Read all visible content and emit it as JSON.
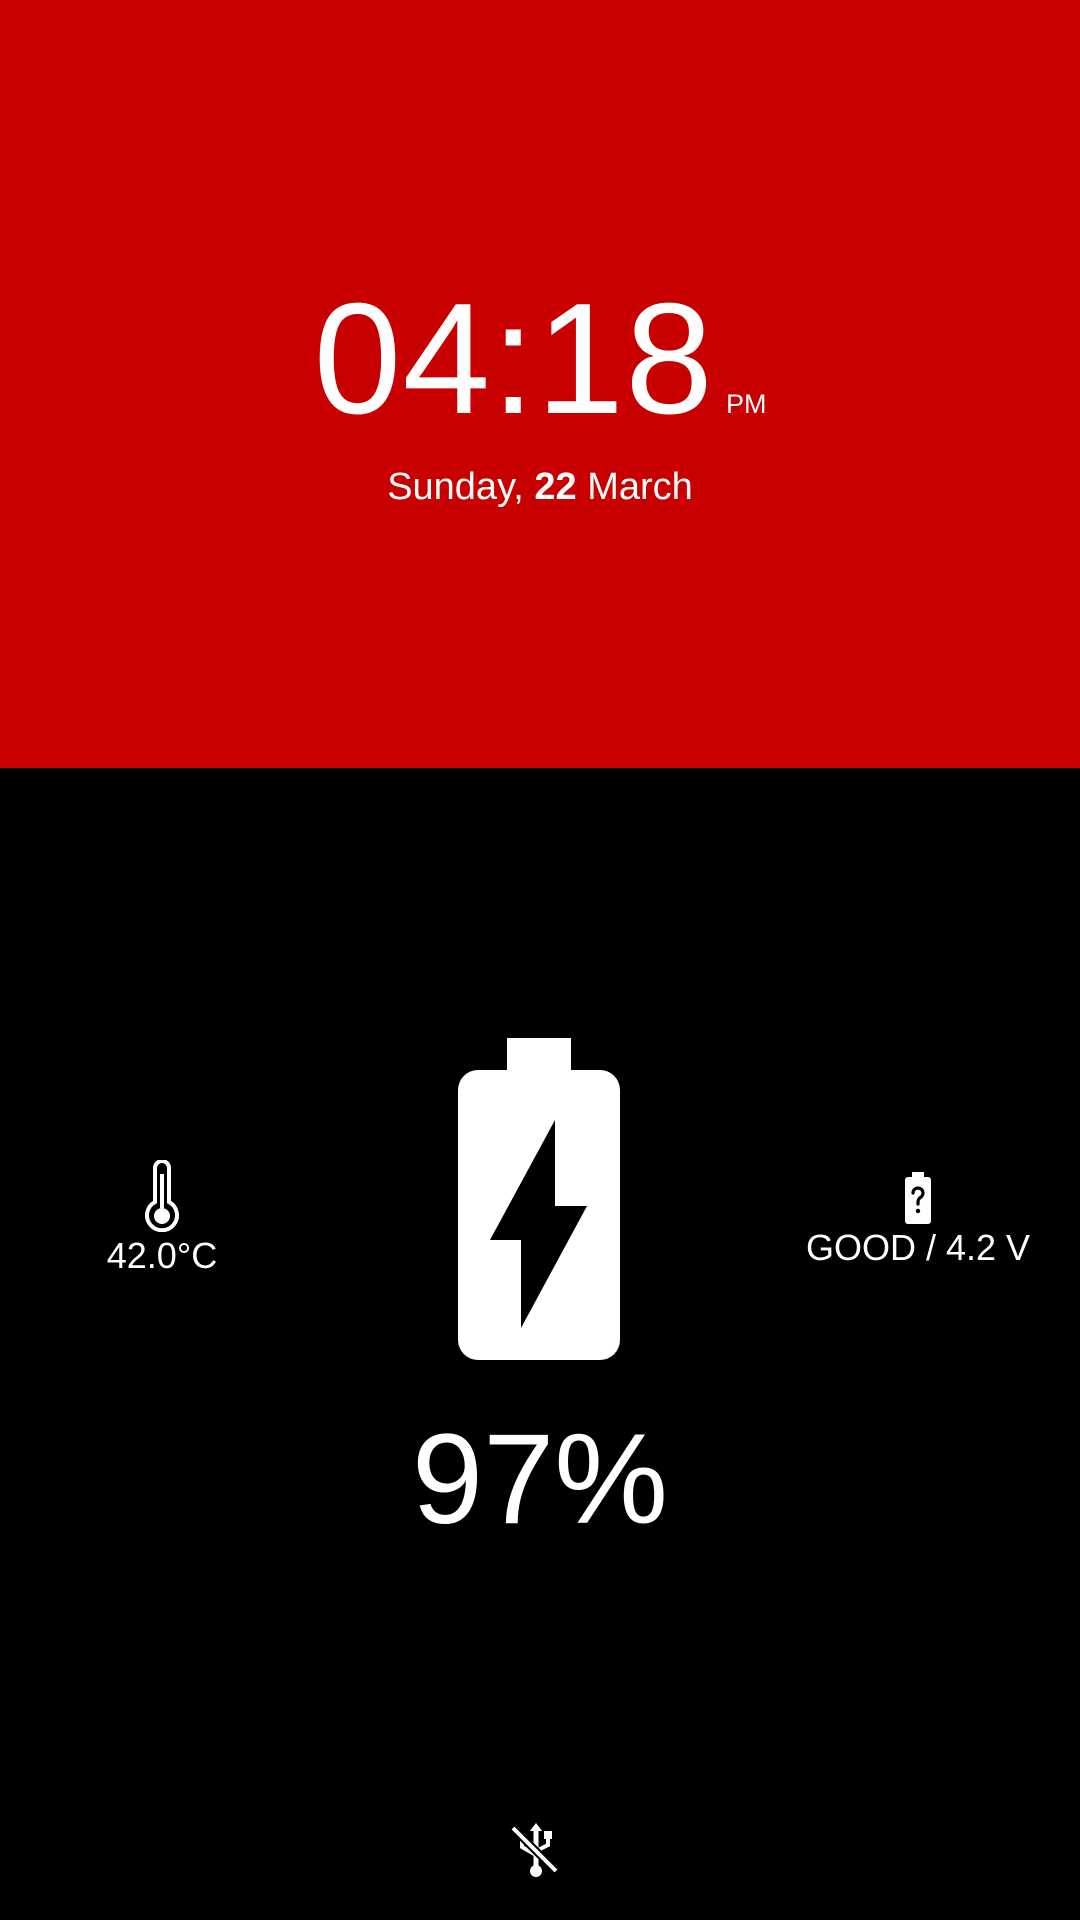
{
  "clock": {
    "time": "04:18",
    "ampm": "PM"
  },
  "date": {
    "weekday": "Sunday,",
    "day": "22",
    "month": "March"
  },
  "battery": {
    "level_percent": 97,
    "label": "97%",
    "state_icon": "battery-charging-icon"
  },
  "temperature": {
    "icon": "thermometer-icon",
    "label": "42.0°C"
  },
  "health": {
    "icon": "battery-unknown-icon",
    "label": "GOOD / 4.2 V"
  },
  "power_source": {
    "icon": "usb-off-icon"
  },
  "colors": {
    "top_background": "#c80000",
    "bottom_background": "#000000",
    "foreground": "#ffffff"
  }
}
